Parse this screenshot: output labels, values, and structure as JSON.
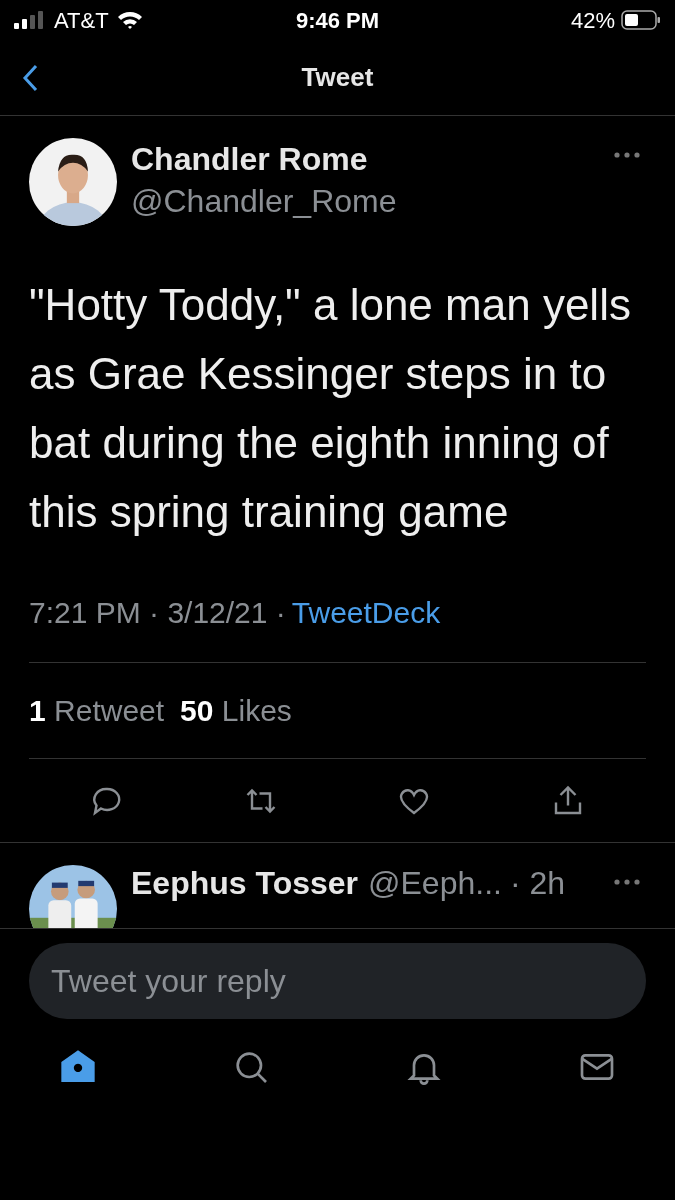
{
  "status_bar": {
    "carrier": "AT&T",
    "time": "9:46 PM",
    "battery": "42%"
  },
  "nav": {
    "title": "Tweet"
  },
  "tweet": {
    "author": "Chandler Rome",
    "handle": "@Chandler_Rome",
    "text": "\"Hotty Toddy,\" a lone man yells as Grae Kessinger steps in to bat during the eighth inning of this spring training game",
    "timestamp": "7:21 PM · 3/12/21 ·",
    "source": "TweetDeck",
    "retweets_count": "1",
    "retweets_label": "Retweet",
    "likes_count": "50",
    "likes_label": "Likes"
  },
  "reply": {
    "author": "Eephus Tosser",
    "handle": "@Eeph...",
    "age": "· 2h"
  },
  "composer": {
    "placeholder": "Tweet your reply"
  },
  "tab_bar": [
    {
      "kind": "home",
      "selected": true
    },
    {
      "kind": "search",
      "selected": false
    },
    {
      "kind": "notifications",
      "selected": false
    },
    {
      "kind": "messages",
      "selected": false
    }
  ]
}
